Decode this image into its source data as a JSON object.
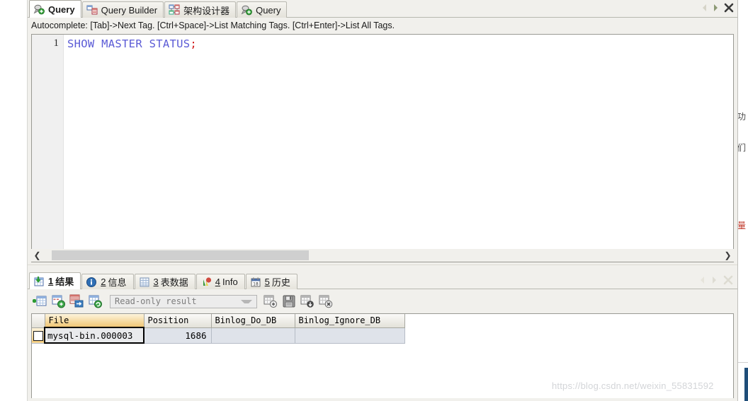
{
  "app": {
    "editor_tabs": [
      {
        "label": "Query",
        "icon": "query-icon",
        "active": true
      },
      {
        "label": "Query Builder",
        "icon": "query-builder-icon",
        "active": false
      },
      {
        "label": "架构设计器",
        "icon": "schema-designer-icon",
        "active": false
      },
      {
        "label": "Query",
        "icon": "query-icon",
        "active": false
      }
    ],
    "tabstrip_controls": {
      "scroll_left": "◀",
      "scroll_right": "▶",
      "close": "✕"
    }
  },
  "hint": {
    "text": "Autocomplete: [Tab]->Next Tag. [Ctrl+Space]->List Matching Tags. [Ctrl+Enter]->List All Tags."
  },
  "editor": {
    "line_number": "1",
    "sql_keywords": "SHOW MASTER STATUS",
    "sql_terminator": ";",
    "scroll_left_glyph": "❮",
    "scroll_right_glyph": "❯"
  },
  "results": {
    "tabs": [
      {
        "num": "1",
        "label": "结果",
        "icon": "result-grid-icon",
        "active": true
      },
      {
        "num": "2",
        "label": "信息",
        "icon": "info-bubble-icon",
        "active": false
      },
      {
        "num": "3",
        "label": "表数据",
        "icon": "table-data-icon",
        "active": false
      },
      {
        "num": "4",
        "label": "Info",
        "icon": "chart-icon",
        "active": false
      },
      {
        "num": "5",
        "label": "历史",
        "icon": "calendar-icon",
        "active": false
      }
    ],
    "toolbar": {
      "buttons_left": [
        {
          "name": "insert-record-icon",
          "title": "Insert record"
        },
        {
          "name": "duplicate-record-icon",
          "title": "Duplicate record"
        },
        {
          "name": "edit-record-icon",
          "title": "Edit record"
        },
        {
          "name": "refresh-record-icon",
          "title": "Refresh record"
        }
      ],
      "mode_select": {
        "value": "Read-only result",
        "placeholder": "Read-only result"
      },
      "buttons_right": [
        {
          "name": "add-grid-icon",
          "title": "Add"
        },
        {
          "name": "save-grid-icon",
          "title": "Save"
        },
        {
          "name": "export-grid-icon",
          "title": "Export"
        },
        {
          "name": "close-grid-icon",
          "title": "Close"
        }
      ]
    },
    "grid": {
      "columns": [
        "File",
        "Position",
        "Binlog_Do_DB",
        "Binlog_Ignore_DB"
      ],
      "selected_column": "File",
      "rows": [
        {
          "File": "mysql-bin.000003",
          "Position": "1686",
          "Binlog_Do_DB": "",
          "Binlog_Ignore_DB": ""
        }
      ]
    },
    "strip_controls": {
      "scroll_left": "◀",
      "scroll_right": "▶",
      "close": "✕"
    }
  },
  "watermark": {
    "text": "https://blog.csdn.net/weixin_55831592"
  },
  "colors": {
    "sql_keyword": "#5b5bd6",
    "sql_punct": "#d01b1b",
    "selected_column_header": "#f0c775",
    "selected_row_cell": "#dfe3ea",
    "window_chrome": "#f1f0ec"
  }
}
